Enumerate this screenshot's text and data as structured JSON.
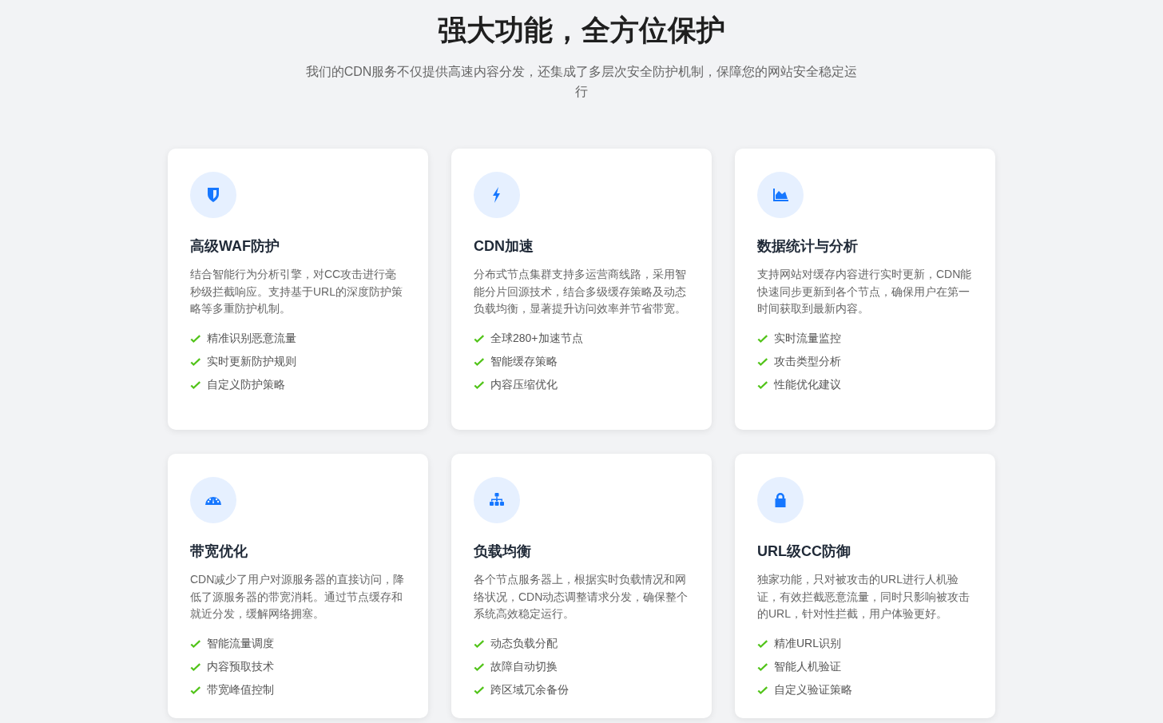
{
  "heading": "强大功能，全方位保护",
  "subtitle": "我们的CDN服务不仅提供高速内容分发，还集成了多层次安全防护机制，保障您的网站安全稳定运行",
  "features": [
    {
      "title": "高级WAF防护",
      "description": "结合智能行为分析引擎，对CC攻击进行毫秒级拦截响应。支持基于URL的深度防护策略等多重防护机制。",
      "points": [
        "精准识别恶意流量",
        "实时更新防护规则",
        "自定义防护策略"
      ]
    },
    {
      "title": "CDN加速",
      "description": "分布式节点集群支持多运营商线路，采用智能分片回源技术，结合多级缓存策略及动态负载均衡，显著提升访问效率并节省带宽。",
      "points": [
        "全球280+加速节点",
        "智能缓存策略",
        "内容压缩优化"
      ]
    },
    {
      "title": "数据统计与分析",
      "description": "支持网站对缓存内容进行实时更新，CDN能快速同步更新到各个节点，确保用户在第一时间获取到最新内容。",
      "points": [
        "实时流量监控",
        "攻击类型分析",
        "性能优化建议"
      ]
    },
    {
      "title": "带宽优化",
      "description": "CDN减少了用户对源服务器的直接访问，降低了源服务器的带宽消耗。通过节点缓存和就近分发，缓解网络拥塞。",
      "points": [
        "智能流量调度",
        "内容预取技术",
        "带宽峰值控制"
      ]
    },
    {
      "title": "负载均衡",
      "description": "各个节点服务器上，根据实时负载情况和网络状况，CDN动态调整请求分发，确保整个系统高效稳定运行。",
      "points": [
        "动态负载分配",
        "故障自动切换",
        "跨区域冗余备份"
      ]
    },
    {
      "title": "URL级CC防御",
      "description": "独家功能，只对被攻击的URL进行人机验证，有效拦截恶意流量，同时只影响被攻击的URL，针对性拦截，用户体验更好。",
      "points": [
        "精准URL识别",
        "智能人机验证",
        "自定义验证策略"
      ]
    }
  ]
}
